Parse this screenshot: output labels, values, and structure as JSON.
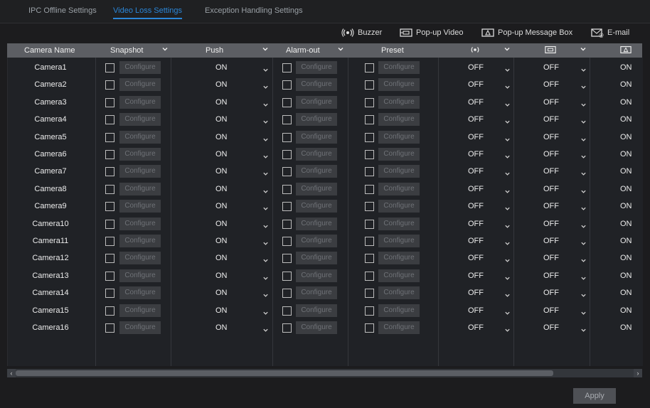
{
  "tabs": [
    {
      "label": "IPC Offline Settings",
      "active": false
    },
    {
      "label": "Video Loss Settings",
      "active": true
    },
    {
      "label": "Exception Handling Settings",
      "active": false
    }
  ],
  "legend": {
    "buzzer": {
      "label": "Buzzer",
      "icon": "buzzer-icon"
    },
    "popup_video": {
      "label": "Pop-up Video",
      "icon": "popup-video-icon"
    },
    "popup_message": {
      "label": "Pop-up Message Box",
      "icon": "popup-message-icon"
    },
    "email": {
      "label": "E-mail",
      "icon": "email-icon"
    }
  },
  "columns": {
    "camera_name": "Camera Name",
    "snapshot": "Snapshot",
    "push": "Push",
    "alarm_out": "Alarm-out",
    "preset": "Preset",
    "buzzer_icon": "buzzer-icon",
    "popup_video_icon": "popup-video-icon",
    "popup_message_icon": "popup-message-icon"
  },
  "configure_label": "Configure",
  "rows": [
    {
      "camera": "Camera1",
      "push": "ON",
      "buzzer": "OFF",
      "popup_video": "OFF",
      "popup_message": "ON"
    },
    {
      "camera": "Camera2",
      "push": "ON",
      "buzzer": "OFF",
      "popup_video": "OFF",
      "popup_message": "ON"
    },
    {
      "camera": "Camera3",
      "push": "ON",
      "buzzer": "OFF",
      "popup_video": "OFF",
      "popup_message": "ON"
    },
    {
      "camera": "Camera4",
      "push": "ON",
      "buzzer": "OFF",
      "popup_video": "OFF",
      "popup_message": "ON"
    },
    {
      "camera": "Camera5",
      "push": "ON",
      "buzzer": "OFF",
      "popup_video": "OFF",
      "popup_message": "ON"
    },
    {
      "camera": "Camera6",
      "push": "ON",
      "buzzer": "OFF",
      "popup_video": "OFF",
      "popup_message": "ON"
    },
    {
      "camera": "Camera7",
      "push": "ON",
      "buzzer": "OFF",
      "popup_video": "OFF",
      "popup_message": "ON"
    },
    {
      "camera": "Camera8",
      "push": "ON",
      "buzzer": "OFF",
      "popup_video": "OFF",
      "popup_message": "ON"
    },
    {
      "camera": "Camera9",
      "push": "ON",
      "buzzer": "OFF",
      "popup_video": "OFF",
      "popup_message": "ON"
    },
    {
      "camera": "Camera10",
      "push": "ON",
      "buzzer": "OFF",
      "popup_video": "OFF",
      "popup_message": "ON"
    },
    {
      "camera": "Camera11",
      "push": "ON",
      "buzzer": "OFF",
      "popup_video": "OFF",
      "popup_message": "ON"
    },
    {
      "camera": "Camera12",
      "push": "ON",
      "buzzer": "OFF",
      "popup_video": "OFF",
      "popup_message": "ON"
    },
    {
      "camera": "Camera13",
      "push": "ON",
      "buzzer": "OFF",
      "popup_video": "OFF",
      "popup_message": "ON"
    },
    {
      "camera": "Camera14",
      "push": "ON",
      "buzzer": "OFF",
      "popup_video": "OFF",
      "popup_message": "ON"
    },
    {
      "camera": "Camera15",
      "push": "ON",
      "buzzer": "OFF",
      "popup_video": "OFF",
      "popup_message": "ON"
    },
    {
      "camera": "Camera16",
      "push": "ON",
      "buzzer": "OFF",
      "popup_video": "OFF",
      "popup_message": "ON"
    }
  ],
  "apply_label": "Apply",
  "colors": {
    "accent": "#2b86d8",
    "header_bg": "#5c5e63",
    "bg": "#1c1c1e"
  }
}
